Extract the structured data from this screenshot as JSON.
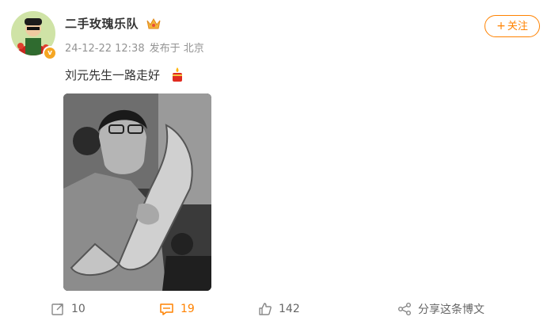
{
  "post": {
    "author": "二手玫瑰乐队",
    "timestamp": "24-12-22 12:38",
    "source": "发布于 北京",
    "follow_label": "关注",
    "follow_plus": "+",
    "text": "刘元先生一路走好"
  },
  "actions": {
    "repost_count": "10",
    "comment_count": "19",
    "like_count": "142",
    "share_label": "分享这条博文"
  },
  "colors": {
    "accent": "#ff8200",
    "meta": "#939393",
    "badge": "#f5a623"
  },
  "icons": [
    "verified-badge-icon",
    "crown-icon",
    "candle-emoji-icon",
    "repost-icon",
    "comment-icon",
    "like-icon",
    "share-icon"
  ]
}
